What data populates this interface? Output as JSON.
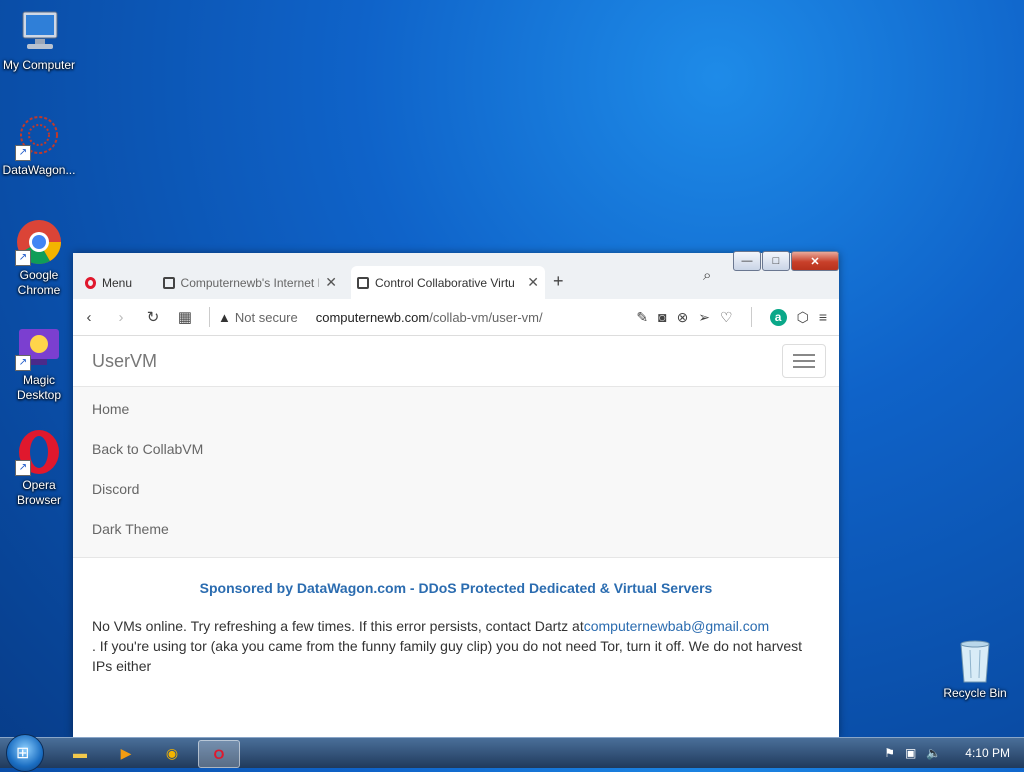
{
  "desktop": {
    "icons": [
      {
        "label": "My Computer",
        "icon": "computer-icon"
      },
      {
        "label": "DataWagon...",
        "icon": "datawagon-icon"
      },
      {
        "label": "Google Chrome",
        "icon": "chrome-icon"
      },
      {
        "label": "Magic Desktop",
        "icon": "magic-desktop-icon"
      },
      {
        "label": "Opera Browser",
        "icon": "opera-icon"
      },
      {
        "label": "Recycle Bin",
        "icon": "recycle-bin-icon"
      }
    ]
  },
  "window_controls": {
    "min": "—",
    "max": "□",
    "close": "✕"
  },
  "browser": {
    "menu_label": "Menu",
    "tabs": [
      {
        "label": "Computernewb's Internet M",
        "active": false
      },
      {
        "label": "Control Collaborative Virtu",
        "active": true
      }
    ],
    "new_tab": "+",
    "address": {
      "security": "Not secure",
      "host": "computernewb.com",
      "path": "/collab-vm/user-vm/"
    }
  },
  "page": {
    "brand": "UserVM",
    "menu": [
      "Home",
      "Back to CollabVM",
      "Discord",
      "Dark Theme"
    ],
    "sponsor": "Sponsored by DataWagon.com - DDoS Protected Dedicated & Virtual Servers",
    "message_part1": "No VMs online. Try refreshing a few times. If this error persists, contact Dartz at",
    "email": "computernewbab@gmail.com",
    "message_part2": ". If you're using tor (aka you came from the funny family guy clip) you do not need Tor, turn it off. We do not harvest IPs either"
  },
  "taskbar": {
    "clock": "4:10 PM"
  },
  "colors": {
    "link": "#2b6cb0",
    "opera_red": "#e0182d",
    "desktop_blue": "#0f63c9"
  }
}
